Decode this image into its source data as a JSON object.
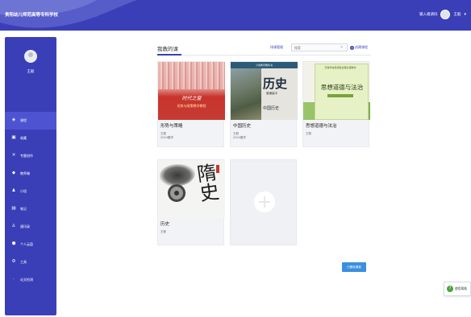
{
  "header": {
    "brand": "贵阳幼儿师范高等专科学校",
    "user_role": "输入邀请码",
    "user_name": "王毅"
  },
  "sidebar": {
    "user_name": "王毅",
    "items": [
      {
        "label": "课程",
        "icon": "course-icon",
        "active": true
      },
      {
        "label": "收藏",
        "icon": "bookmark-icon"
      },
      {
        "label": "专题创作",
        "icon": "topic-icon"
      },
      {
        "label": "教师端",
        "icon": "teacher-icon"
      },
      {
        "label": "小组",
        "icon": "group-icon"
      },
      {
        "label": "笔记",
        "icon": "note-icon"
      },
      {
        "label": "通讯录",
        "icon": "contacts-icon"
      },
      {
        "label": "个人云盘",
        "icon": "cloud-disk-icon"
      },
      {
        "label": "工具",
        "icon": "tools-icon"
      },
      {
        "label": "论文检测",
        "icon": "paper-check-icon"
      }
    ]
  },
  "main": {
    "title": "我教的课",
    "link_label": "排课管理",
    "search_placeholder": "搜索",
    "add_course_label": "创建课程"
  },
  "courses": [
    {
      "name": "形势与策略",
      "teacher": "王毅",
      "year": "2024春学",
      "cover_title": "时代之窗",
      "cover_subtitle": "形势与政策教学教程"
    },
    {
      "name": "中国历史",
      "teacher": "王毅",
      "year": "2024春学",
      "cover_band": "义务教育教科书",
      "cover_title": "历史",
      "cover_sub1": "普通高中",
      "cover_sub2": "中国历史"
    },
    {
      "name": "思想道德与法治",
      "teacher": "王毅",
      "cover_header": "高等学校思想政治理论课教材",
      "cover_title": "思想道德与法治"
    },
    {
      "name": "历史",
      "teacher": "王毅",
      "cover_callig": "隋史"
    }
  ],
  "footer": {
    "archived_label": "已删除课程",
    "help_label": "使用帮助"
  },
  "colors": {
    "brand": "#3a3fb8",
    "accent": "#3b8fe0",
    "help_green": "#49a13a"
  }
}
